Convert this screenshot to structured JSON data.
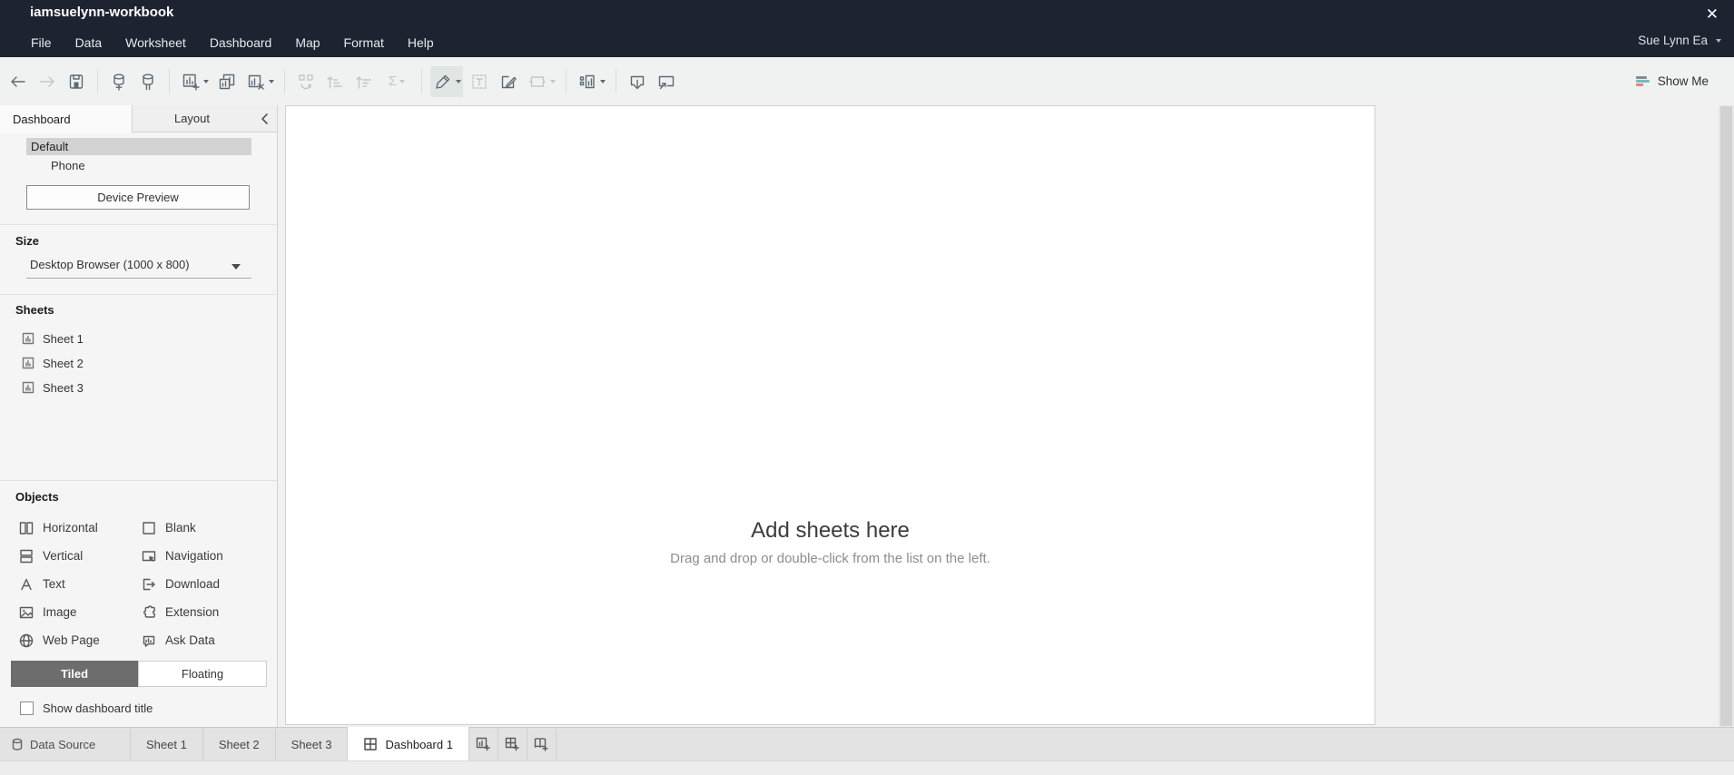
{
  "colors": {
    "titlebar_bg": "#1d2331",
    "toolbar_bg": "#f0f2f1",
    "sidebar_bg": "#f5f5f5",
    "selected_row": "#d2d2d2",
    "tiled_active_bg": "#6d6d6d",
    "show_me_gray": "#7f8e92",
    "show_me_teal": "#6fc0c3",
    "show_me_coral": "#e4847b"
  },
  "titlebar": {
    "title": "iamsuelynn-workbook",
    "close_glyph": "✕",
    "user_menu": "Sue Lynn Ea"
  },
  "menubar": {
    "items": [
      "File",
      "Data",
      "Worksheet",
      "Dashboard",
      "Map",
      "Format",
      "Help"
    ]
  },
  "toolbar": {
    "icons": [
      "undo-icon",
      "redo-icon",
      "save-icon",
      "new-data-source-icon",
      "pause-auto-updates-icon",
      "new-worksheet-icon",
      "duplicate-sheet-icon",
      "clear-sheet-icon",
      "swap-rows-columns-icon",
      "sort-ascending-icon",
      "sort-descending-icon",
      "totals-icon",
      "highlight-icon",
      "show-mark-labels-icon",
      "fix-axes-icon",
      "format-borders-icon",
      "fit-selector-icon",
      "publish-icon",
      "presentation-mode-icon"
    ],
    "sigma_glyph": "Σ",
    "show_me_label": "Show Me"
  },
  "sidebar": {
    "tabs": [
      {
        "label": "Dashboard",
        "active": true
      },
      {
        "label": "Layout",
        "active": false
      }
    ],
    "devices": [
      {
        "label": "Default",
        "selected": true
      },
      {
        "label": "Phone",
        "selected": false
      }
    ],
    "device_preview_label": "Device Preview",
    "size_heading": "Size",
    "size_value": "Desktop Browser (1000 x 800)",
    "sheets_heading": "Sheets",
    "sheets": [
      "Sheet 1",
      "Sheet 2",
      "Sheet 3"
    ],
    "objects_heading": "Objects",
    "objects_left": [
      "Horizontal",
      "Vertical",
      "Text",
      "Image",
      "Web Page"
    ],
    "objects_right": [
      "Blank",
      "Navigation",
      "Download",
      "Extension",
      "Ask Data"
    ],
    "tiled_label": "Tiled",
    "floating_label": "Floating",
    "show_title_label": "Show dashboard title"
  },
  "canvas": {
    "title": "Add sheets here",
    "subtitle": "Drag and drop or double-click from the list on the left."
  },
  "bottombar": {
    "data_source_label": "Data Source",
    "tabs": [
      "Sheet 1",
      "Sheet 2",
      "Sheet 3"
    ],
    "active_tab": "Dashboard 1"
  }
}
